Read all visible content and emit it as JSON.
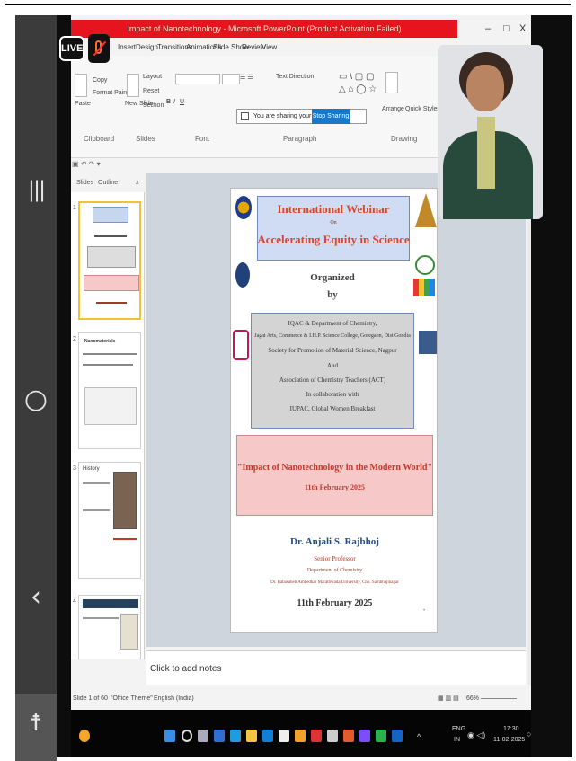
{
  "window": {
    "title": "Impact of Nanotechnology - Microsoft PowerPoint (Product Activation Failed)",
    "controls": [
      "–",
      "□",
      "X"
    ]
  },
  "overlay": {
    "live_label": "LIVE"
  },
  "ribbon": {
    "tabs": [
      "Insert",
      "Design",
      "Transitions",
      "Animations",
      "Slide Show",
      "Review",
      "View"
    ],
    "groups": [
      "Clipboard",
      "Slides",
      "Font",
      "Paragraph",
      "Drawing"
    ],
    "paste": "Paste",
    "copy": "Copy",
    "format_painter": "Format Painter",
    "new_slide": "New Slide",
    "layout": "Layout",
    "reset": "Reset",
    "section": "Section",
    "text_direction": "Text Direction",
    "arrange": "Arrange",
    "quick_styles": "Quick Styles"
  },
  "sharing": {
    "message": "You are sharing your entire screen.",
    "stop_label": "Stop Sharing"
  },
  "panel": {
    "tabs": [
      "Slides",
      "Outline"
    ],
    "close": "x",
    "thumbs": [
      {
        "num": "1"
      },
      {
        "num": "2"
      },
      {
        "num": "3"
      },
      {
        "num": "4"
      }
    ],
    "thumb3_text": "History",
    "thumb2_title": "Nanomaterials"
  },
  "slide": {
    "title1": "International Webinar",
    "on": "On",
    "title2": "Accelerating Equity in Science",
    "organized": "Organized",
    "by": "by",
    "org_lines": [
      "IQAC & Department of Chemistry,",
      "Jagat Arts, Commerce & I.H.P. Science College, Goregaon, Dist Gondia",
      "Society for Promotion of Material Science, Nagpur",
      "And",
      "Association of Chemistry Teachers (ACT)",
      "In collaboration with",
      "IUPAC, Global Women Breakfast"
    ],
    "talk_title": "\"Impact of Nanotechnology in the Modern World\"",
    "talk_date": "11th February 2025",
    "speaker": "Dr. Anjali S. Rajbhoj",
    "designation": "Senior Professor",
    "department": "Department of Chemistry",
    "university": "Dr. Babasaheb Ambedkar Marathwada University, Chh. Sambhajinagar",
    "date": "11th February 2025"
  },
  "notes": {
    "placeholder": "Click to add notes"
  },
  "status": {
    "slide": "Slide 1 of 60",
    "theme": "\"Office Theme\"",
    "language": "English (India)",
    "zoom": "66%"
  },
  "taskbar": {
    "lang": "ENG",
    "region": "IN",
    "time": "17:30",
    "date": "11-02-2025"
  },
  "colors": {
    "title_red": "#d7462f",
    "accent_blue": "#1a78c8",
    "titlebar": "#e5141e"
  }
}
